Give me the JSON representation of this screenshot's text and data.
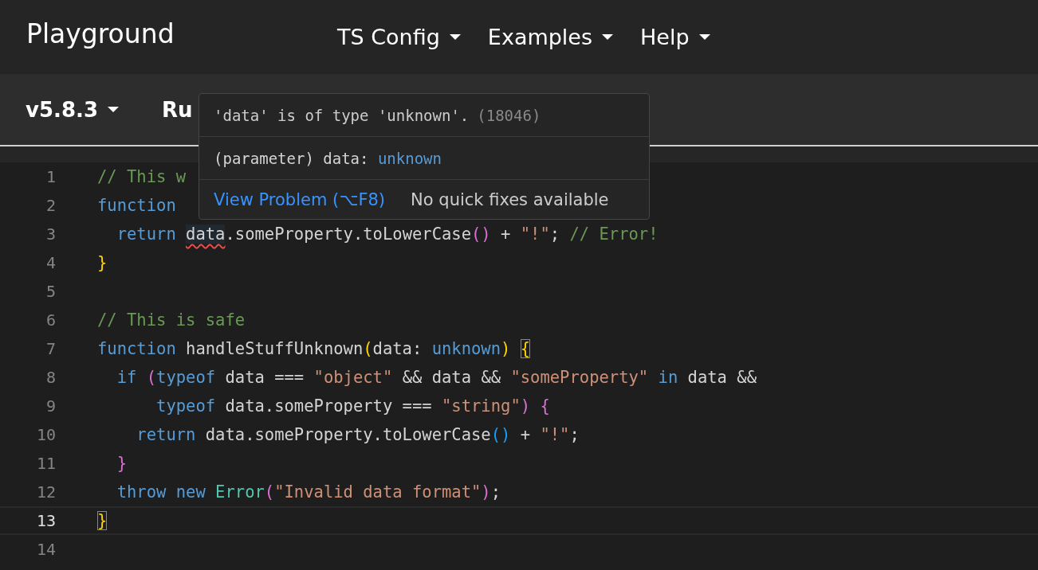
{
  "header": {
    "title": "Playground",
    "menus": [
      {
        "label": "TS Config"
      },
      {
        "label": "Examples"
      },
      {
        "label": "Help"
      }
    ]
  },
  "toolbar": {
    "version": "v5.8.3",
    "run": "Ru"
  },
  "editor": {
    "lines": [
      {
        "number": "1",
        "current": false,
        "tokens": [
          {
            "text": "// This w",
            "kind": "comment"
          }
        ]
      },
      {
        "number": "2",
        "current": false,
        "tokens": [
          {
            "text": "function ",
            "kind": "keyword"
          }
        ]
      },
      {
        "number": "3",
        "current": false,
        "tokens": [
          {
            "text": "  return ",
            "kind": "keyword"
          },
          {
            "text": "data",
            "kind": "plain",
            "error": true
          },
          {
            "text": ".someProperty.toLowerCase",
            "kind": "plain"
          },
          {
            "text": "()",
            "kind": "bracket2"
          },
          {
            "text": " + ",
            "kind": "plain"
          },
          {
            "text": "\"!\"",
            "kind": "string"
          },
          {
            "text": "; ",
            "kind": "plain"
          },
          {
            "text": "// Error!",
            "kind": "comment"
          }
        ]
      },
      {
        "number": "4",
        "current": false,
        "tokens": [
          {
            "text": "}",
            "kind": "bracket1"
          }
        ]
      },
      {
        "number": "5",
        "current": false
      },
      {
        "number": "6",
        "current": false,
        "tokens": [
          {
            "text": "// This is safe",
            "kind": "comment"
          }
        ]
      },
      {
        "number": "7",
        "current": false,
        "tokens": [
          {
            "text": "function",
            "kind": "keyword"
          },
          {
            "text": " handleStuffUnknown",
            "kind": "plain"
          },
          {
            "text": "(",
            "kind": "bracket1"
          },
          {
            "text": "data: ",
            "kind": "plain"
          },
          {
            "text": "unknown",
            "kind": "keyword"
          },
          {
            "text": ") ",
            "kind": "bracket1"
          },
          {
            "text": "{",
            "kind": "bracket1",
            "matched": true
          }
        ]
      },
      {
        "number": "8",
        "current": false,
        "tokens": [
          {
            "text": "  if ",
            "kind": "keyword"
          },
          {
            "text": "(",
            "kind": "bracket2"
          },
          {
            "text": "typeof",
            "kind": "keyword"
          },
          {
            "text": " data === ",
            "kind": "plain"
          },
          {
            "text": "\"object\"",
            "kind": "string"
          },
          {
            "text": " && data && ",
            "kind": "plain"
          },
          {
            "text": "\"someProperty\" ",
            "kind": "string"
          },
          {
            "text": "in",
            "kind": "keyword"
          },
          {
            "text": " data &&",
            "kind": "plain"
          }
        ]
      },
      {
        "number": "9",
        "current": false,
        "tokens": [
          {
            "text": "      typeof",
            "kind": "keyword"
          },
          {
            "text": " data.someProperty === ",
            "kind": "plain"
          },
          {
            "text": "\"string\"",
            "kind": "string"
          },
          {
            "text": ") ",
            "kind": "bracket2"
          },
          {
            "text": "{",
            "kind": "bracket2"
          }
        ]
      },
      {
        "number": "10",
        "current": false,
        "tokens": [
          {
            "text": "    return",
            "kind": "keyword"
          },
          {
            "text": " data.someProperty.toLowerCase",
            "kind": "plain"
          },
          {
            "text": "()",
            "kind": "bracket3"
          },
          {
            "text": " + ",
            "kind": "plain"
          },
          {
            "text": "\"!\"",
            "kind": "string"
          },
          {
            "text": ";",
            "kind": "plain"
          }
        ]
      },
      {
        "number": "11",
        "current": false,
        "tokens": [
          {
            "text": "  }",
            "kind": "bracket2"
          }
        ]
      },
      {
        "number": "12",
        "current": false,
        "tokens": [
          {
            "text": "  throw new ",
            "kind": "keyword"
          },
          {
            "text": "Error",
            "kind": "class"
          },
          {
            "text": "(",
            "kind": "bracket2"
          },
          {
            "text": "\"Invalid data format\"",
            "kind": "string"
          },
          {
            "text": ")",
            "kind": "bracket2"
          },
          {
            "text": ";",
            "kind": "plain"
          }
        ]
      },
      {
        "number": "13",
        "current": true,
        "tokens": [
          {
            "text": "}",
            "kind": "bracket1",
            "matched": true
          }
        ]
      },
      {
        "number": "14",
        "current": false
      }
    ]
  },
  "tooltip": {
    "message": "'data' is of type 'unknown'.",
    "code": "(18046)",
    "signature": [
      {
        "text": "(parameter) data: ",
        "kind": "plain"
      },
      {
        "text": "unknown",
        "kind": "keyword"
      }
    ],
    "link": "View Problem (⌥F8)",
    "note": "No quick fixes available"
  }
}
